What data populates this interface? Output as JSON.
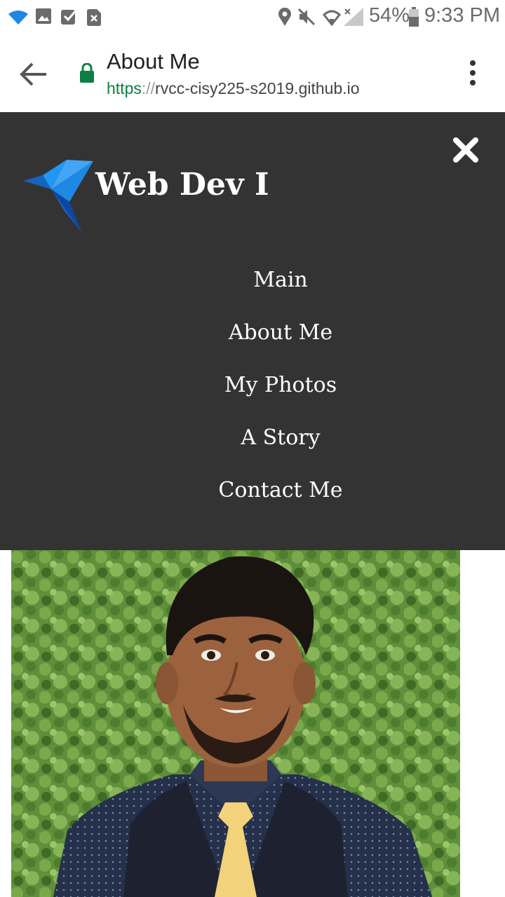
{
  "status_bar": {
    "battery": "54%",
    "time": "9:33 PM"
  },
  "browser": {
    "page_title": "About Me",
    "url_scheme": "https",
    "url_separator": "://",
    "url_host": "rvcc-cisy225-s2019.github.io"
  },
  "site": {
    "brand": "Web Dev I",
    "nav": [
      {
        "label": "Main"
      },
      {
        "label": "About Me"
      },
      {
        "label": "My Photos"
      },
      {
        "label": "A Story"
      },
      {
        "label": "Contact Me"
      }
    ]
  },
  "colors": {
    "nav_background": "#333333",
    "secure_lock": "#0b8043",
    "logo_blue": "#1e88e5"
  }
}
